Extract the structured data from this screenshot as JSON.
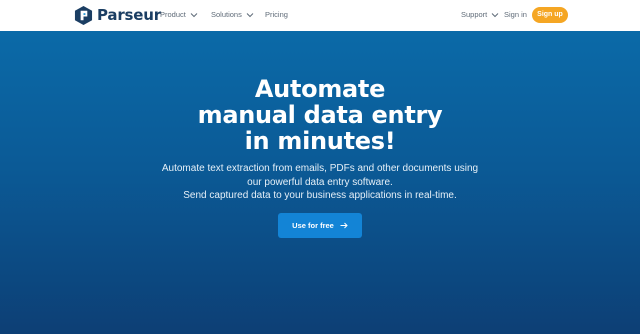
{
  "brand": {
    "name": "Parseur",
    "logo_icon": "parseur-logo-icon",
    "color": "#1b3e63"
  },
  "nav": {
    "product": "Product",
    "solutions": "Solutions",
    "pricing": "Pricing",
    "support": "Support",
    "sign_in": "Sign in",
    "sign_up": "Sign up"
  },
  "hero": {
    "headline_line1": "Automate",
    "headline_line2": "manual data entry",
    "headline_line3": "in minutes!",
    "sub_line1": "Automate text extraction from emails, PDFs and other documents using",
    "sub_line2": "our powerful data entry software.",
    "sub_line3": "Send captured data to your business applications in real-time.",
    "cta_label": "Use for free"
  },
  "colors": {
    "accent": "#f5a623",
    "hero_top": "#0b6aa8",
    "hero_bottom": "#0d3f75",
    "cta": "#1384d6"
  }
}
